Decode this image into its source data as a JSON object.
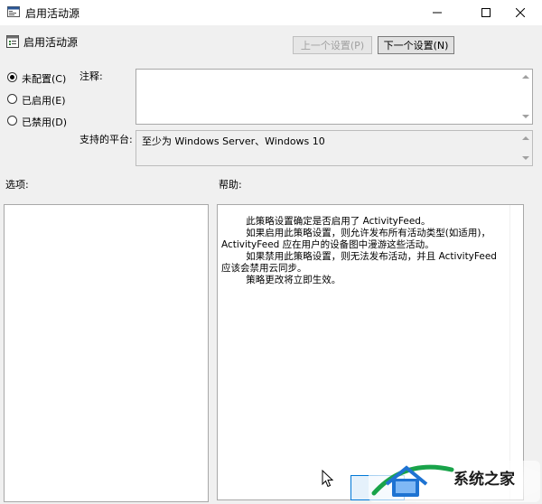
{
  "window": {
    "title": "启用活动源"
  },
  "header": {
    "policy_name": "启用活动源",
    "prev_button": "上一个设置(P)",
    "next_button": "下一个设置(N)"
  },
  "radios": [
    {
      "label": "未配置(C)",
      "checked": true
    },
    {
      "label": "已启用(E)",
      "checked": false
    },
    {
      "label": "已禁用(D)",
      "checked": false
    }
  ],
  "comment": {
    "label": "注释:",
    "value": ""
  },
  "platform": {
    "label": "支持的平台:",
    "value": "至少为 Windows Server、Windows 10"
  },
  "options": {
    "label": "选项:"
  },
  "help": {
    "label": "帮助:",
    "paragraphs": [
      "此策略设置确定是否启用了 ActivityFeed。",
      "如果启用此策略设置，则允许发布所有活动类型(如适用)，ActivityFeed 应在用户的设备图中漫游这些活动。",
      "如果禁用此策略设置，则无法发布活动，并且 ActivityFeed 应该会禁用云同步。",
      "策略更改将立即生效。"
    ]
  },
  "watermark": {
    "text": "系统之家"
  }
}
